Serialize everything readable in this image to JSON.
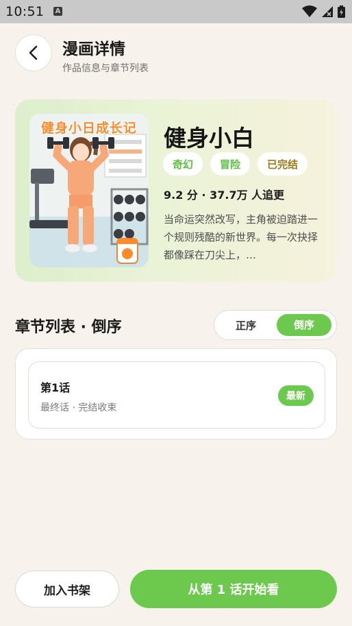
{
  "status_bar": {
    "time": "10:51",
    "icons": [
      "text-a-icon",
      "wifi-icon",
      "signal-icon",
      "battery-icon"
    ]
  },
  "header": {
    "title": "漫画详情",
    "subtitle": "作品信息与章节列表",
    "back_icon": "chevron-left-icon"
  },
  "comic": {
    "cover_title": "健身小日成长记",
    "title": "健身小白",
    "tags": [
      {
        "label": "奇幻",
        "color": "#5bbf3f"
      },
      {
        "label": "冒险",
        "color": "#5bbf3f"
      },
      {
        "label": "已完结",
        "color": "#9a7a1b"
      }
    ],
    "stats": "9.2 分 · 37.7万 人追更",
    "description": "当命运突然改写，主角被迫踏进一个规则残酷的新世界。每一次抉择都像踩在刀尖上，…"
  },
  "chapters": {
    "section_title": "章节列表 · 倒序",
    "sort_options": {
      "asc": "正序",
      "desc": "倒序",
      "selected": "desc"
    },
    "items": [
      {
        "name": "第1话",
        "meta": "最终话 · 完结收束",
        "badge": "最新"
      }
    ]
  },
  "actions": {
    "add_shelf": "加入书架",
    "start_reading": "从第 1 话开始看"
  },
  "colors": {
    "accent": "#6cc94d",
    "background": "#f7f3ec",
    "tag_green": "#5bbf3f",
    "tag_gold": "#9a7a1b"
  }
}
